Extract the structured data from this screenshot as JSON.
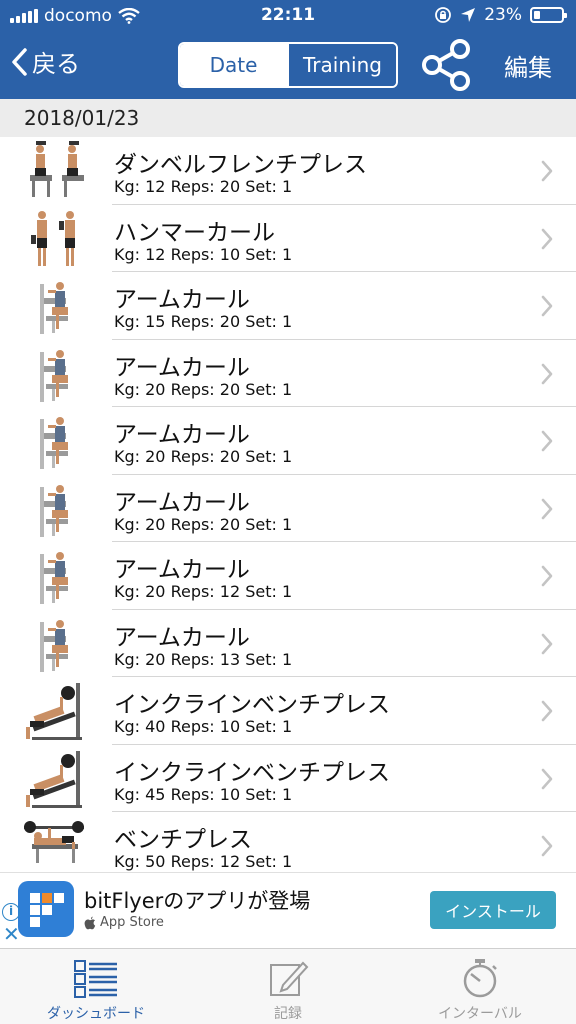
{
  "status_bar": {
    "carrier": "docomo",
    "time": "22:11",
    "battery": "23%",
    "battery_level": 0.23,
    "icons": [
      "signal-icon",
      "wifi-icon",
      "orientation-lock-icon",
      "location-icon",
      "battery-icon"
    ]
  },
  "nav": {
    "back_label": "戻る",
    "segments": [
      "Date",
      "Training"
    ],
    "selected_segment": "Date",
    "edit_label": "編集",
    "share_icon": "share-icon",
    "colors": {
      "bar": "#2b61a8",
      "text": "#ffffff"
    }
  },
  "section": {
    "date": "2018/01/23"
  },
  "rows": [
    {
      "title": "ダンベルフレンチプレス",
      "meta": "Kg: 12 Reps: 20 Set: 1",
      "icon": "dumbbell-french-press-figure"
    },
    {
      "title": "ハンマーカール",
      "meta": "Kg: 12 Reps: 10 Set: 1",
      "icon": "hammer-curl-figure"
    },
    {
      "title": "アームカール",
      "meta": "Kg: 15 Reps: 20 Set: 1",
      "icon": "arm-curl-machine-figure"
    },
    {
      "title": "アームカール",
      "meta": "Kg: 20 Reps: 20 Set: 1",
      "icon": "arm-curl-machine-figure"
    },
    {
      "title": "アームカール",
      "meta": "Kg: 20 Reps: 20 Set: 1",
      "icon": "arm-curl-machine-figure"
    },
    {
      "title": "アームカール",
      "meta": "Kg: 20 Reps: 20 Set: 1",
      "icon": "arm-curl-machine-figure"
    },
    {
      "title": "アームカール",
      "meta": "Kg: 20 Reps: 12 Set: 1",
      "icon": "arm-curl-machine-figure"
    },
    {
      "title": "アームカール",
      "meta": "Kg: 20 Reps: 13 Set: 1",
      "icon": "arm-curl-machine-figure"
    },
    {
      "title": "インクラインベンチプレス",
      "meta": "Kg: 40 Reps: 10 Set: 1",
      "icon": "incline-bench-press-figure"
    },
    {
      "title": "インクラインベンチプレス",
      "meta": "Kg: 45 Reps: 10 Set: 1",
      "icon": "incline-bench-press-figure"
    },
    {
      "title": "ベンチプレス",
      "meta": "Kg: 50 Reps: 12 Set: 1",
      "icon": "bench-press-figure"
    }
  ],
  "ad": {
    "app_name": "bitFlyerのアプリが登場",
    "store_label": "App Store",
    "install_label": "インストール",
    "accent": "#3aa2c0"
  },
  "tabbar": {
    "tabs": [
      {
        "label": "ダッシュボード",
        "icon": "dashboard-icon",
        "active": true
      },
      {
        "label": "記録",
        "icon": "edit-note-icon",
        "active": false
      },
      {
        "label": "インターバル",
        "icon": "stopwatch-icon",
        "active": false
      }
    ],
    "active_color": "#2b61a8",
    "inactive_color": "#9b9b9b"
  }
}
